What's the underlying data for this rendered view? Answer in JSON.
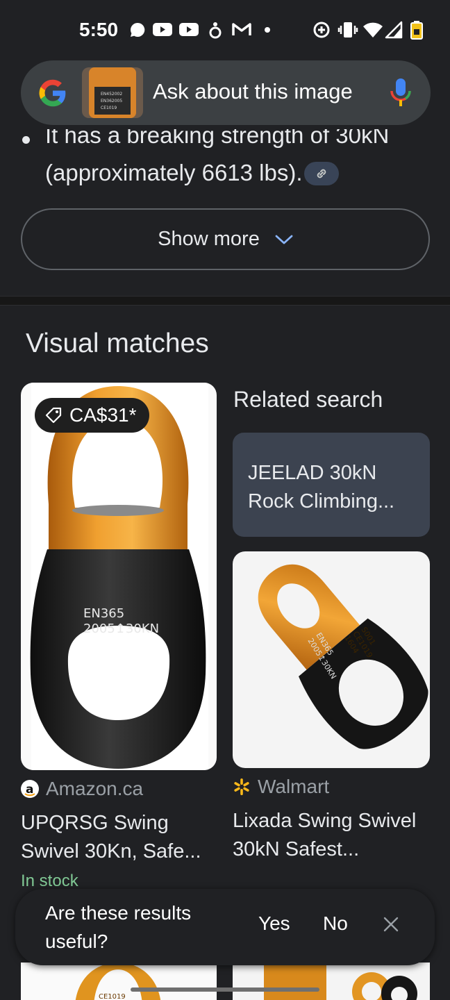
{
  "status_bar": {
    "time": "5:50"
  },
  "search": {
    "placeholder": "Ask about this image",
    "text": "Ask about this image"
  },
  "answer": {
    "line1": "It has a breaking strength of 30kN",
    "line2": "(approximately 6613 lbs)."
  },
  "show_more": {
    "label": "Show more"
  },
  "visual_matches": {
    "title": "Visual matches",
    "left": {
      "price": "CA$31*",
      "image_text": [
        "EN365",
        "2005↥30KN"
      ],
      "source": "Amazon.ca",
      "title": "UPQRSG Swing Swivel 30Kn, Safe...",
      "stock": "In stock"
    },
    "right": {
      "related_label": "Related search",
      "related_text": "JEELAD 30kN Rock Climbing...",
      "image_text": [
        "EN365",
        "2005↥30KN",
        "S001",
        "CE1019",
        "1604"
      ],
      "source": "Walmart",
      "title": "Lixada Swing Swivel 30kN Safest..."
    },
    "peek_text": "CE1019"
  },
  "feedback": {
    "question": "Are these results useful?",
    "yes": "Yes",
    "no": "No"
  },
  "colors": {
    "background": "#202124",
    "card": "#3c4043",
    "related_card": "#3c4350",
    "stock_green": "#81c995",
    "orange": "#e8901c"
  },
  "icons": [
    "whatsapp-icon",
    "youtube-icon",
    "youtube-icon",
    "app-icon",
    "gmail-icon",
    "dot-icon",
    "data-saver-icon",
    "vibrate-icon",
    "wifi-icon",
    "signal-icon",
    "battery-icon",
    "google-icon",
    "mic-icon",
    "link-icon",
    "chevron-down-icon",
    "tag-icon",
    "amazon-icon",
    "walmart-icon",
    "close-icon"
  ]
}
